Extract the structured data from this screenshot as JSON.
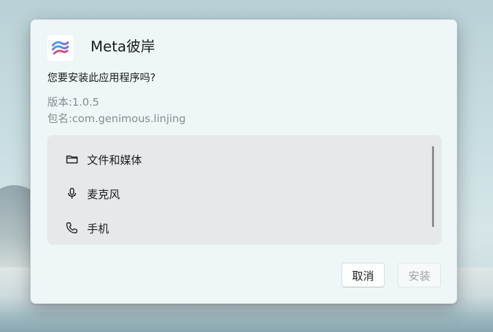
{
  "dialog": {
    "app_name": "Meta彼岸",
    "app_icon": "meta-bian-logo-icon",
    "question": "您要安装此应用程序吗?",
    "version_line": "版本:1.0.5",
    "package_line": "包名:com.genimous.linjing"
  },
  "permissions": [
    {
      "icon": "folder-icon",
      "label": "文件和媒体"
    },
    {
      "icon": "microphone-icon",
      "label": "麦克风"
    },
    {
      "icon": "phone-icon",
      "label": "手机"
    }
  ],
  "buttons": {
    "cancel_label": "取消",
    "install_label": "安装"
  },
  "colors": {
    "logo_gradient_start": "#3fb4f0",
    "logo_gradient_end": "#a347e8",
    "disabled_text": "#a3a6a8"
  }
}
